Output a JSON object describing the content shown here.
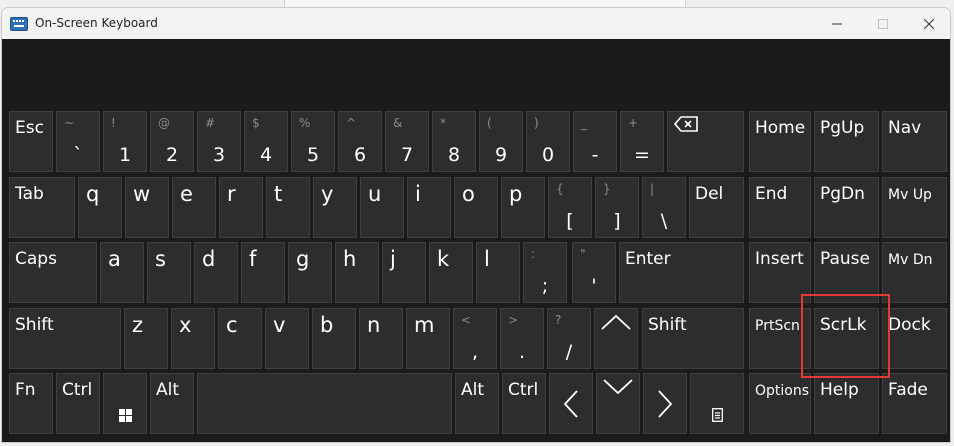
{
  "window": {
    "title": "On-Screen Keyboard"
  },
  "keys": {
    "esc": "Esc",
    "num_row": [
      {
        "shift": "~",
        "main": "`"
      },
      {
        "shift": "!",
        "main": "1"
      },
      {
        "shift": "@",
        "main": "2"
      },
      {
        "shift": "#",
        "main": "3"
      },
      {
        "shift": "$",
        "main": "4"
      },
      {
        "shift": "%",
        "main": "5"
      },
      {
        "shift": "^",
        "main": "6"
      },
      {
        "shift": "&",
        "main": "7"
      },
      {
        "shift": "*",
        "main": "8"
      },
      {
        "shift": "(",
        "main": "9"
      },
      {
        "shift": ")",
        "main": "0"
      },
      {
        "shift": "_",
        "main": "-"
      },
      {
        "shift": "+",
        "main": "="
      }
    ],
    "tab": "Tab",
    "row_q": [
      "q",
      "w",
      "e",
      "r",
      "t",
      "y",
      "u",
      "i",
      "o",
      "p"
    ],
    "brackets": [
      {
        "shift": "{",
        "main": "["
      },
      {
        "shift": "}",
        "main": "]"
      },
      {
        "shift": "|",
        "main": "\\"
      }
    ],
    "del": "Del",
    "caps": "Caps",
    "row_a": [
      "a",
      "s",
      "d",
      "f",
      "g",
      "h",
      "j",
      "k",
      "l"
    ],
    "semi": [
      {
        "shift": ":",
        "main": ";"
      },
      {
        "shift": "\"",
        "main": "'"
      }
    ],
    "enter": "Enter",
    "shift": "Shift",
    "row_z": [
      "z",
      "x",
      "c",
      "v",
      "b",
      "n",
      "m"
    ],
    "punct": [
      {
        "shift": "<",
        "main": ","
      },
      {
        "shift": ">",
        "main": "."
      },
      {
        "shift": "?",
        "main": "/"
      }
    ],
    "fn": "Fn",
    "ctrl": "Ctrl",
    "alt": "Alt",
    "home": "Home",
    "pgup": "PgUp",
    "nav": "Nav",
    "end": "End",
    "pgdn": "PgDn",
    "mvup": "Mv Up",
    "insert": "Insert",
    "pause": "Pause",
    "mvdn": "Mv Dn",
    "prtscn": "PrtScn",
    "scrlk": "ScrLk",
    "dock": "Dock",
    "options": "Options",
    "help": "Help",
    "fade": "Fade"
  }
}
